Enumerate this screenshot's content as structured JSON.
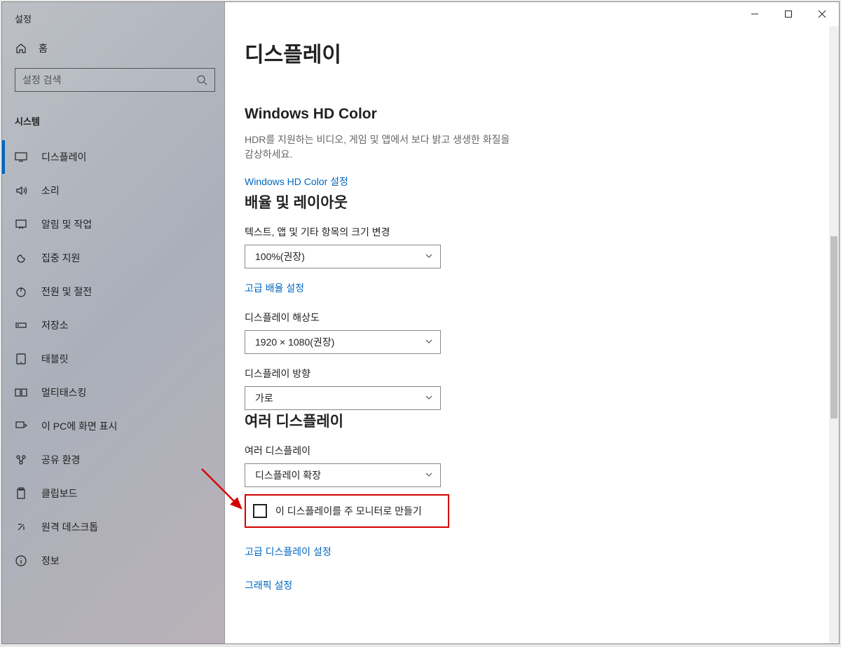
{
  "window": {
    "title": "설정"
  },
  "sidebar": {
    "home_label": "홈",
    "search_placeholder": "설정 검색",
    "category": "시스템",
    "items": [
      {
        "label": "디스플레이"
      },
      {
        "label": "소리"
      },
      {
        "label": "알림 및 작업"
      },
      {
        "label": "집중 지원"
      },
      {
        "label": "전원 및 절전"
      },
      {
        "label": "저장소"
      },
      {
        "label": "태블릿"
      },
      {
        "label": "멀티태스킹"
      },
      {
        "label": "이 PC에 화면 표시"
      },
      {
        "label": "공유 환경"
      },
      {
        "label": "클립보드"
      },
      {
        "label": "원격 데스크톱"
      },
      {
        "label": "정보"
      }
    ]
  },
  "page": {
    "title": "디스플레이",
    "hd_color": {
      "heading": "Windows HD Color",
      "description": "HDR를 지원하는 비디오, 게임 및 앱에서 보다 밝고 생생한 화질을 감상하세요.",
      "link": "Windows HD Color 설정"
    },
    "scale": {
      "heading": "배율 및 레이아웃",
      "text_size_label": "텍스트, 앱 및 기타 항목의 크기 변경",
      "text_size_value": "100%(권장)",
      "advanced_link": "고급 배율 설정",
      "resolution_label": "디스플레이 해상도",
      "resolution_value": "1920 × 1080(권장)",
      "orientation_label": "디스플레이 방향",
      "orientation_value": "가로"
    },
    "multi": {
      "heading": "여러 디스플레이",
      "mode_label": "여러 디스플레이",
      "mode_value": "디스플레이 확장",
      "primary_checkbox": "이 디스플레이를 주 모니터로 만들기",
      "advanced_link": "고급 디스플레이 설정",
      "graphics_link": "그래픽 설정"
    }
  }
}
